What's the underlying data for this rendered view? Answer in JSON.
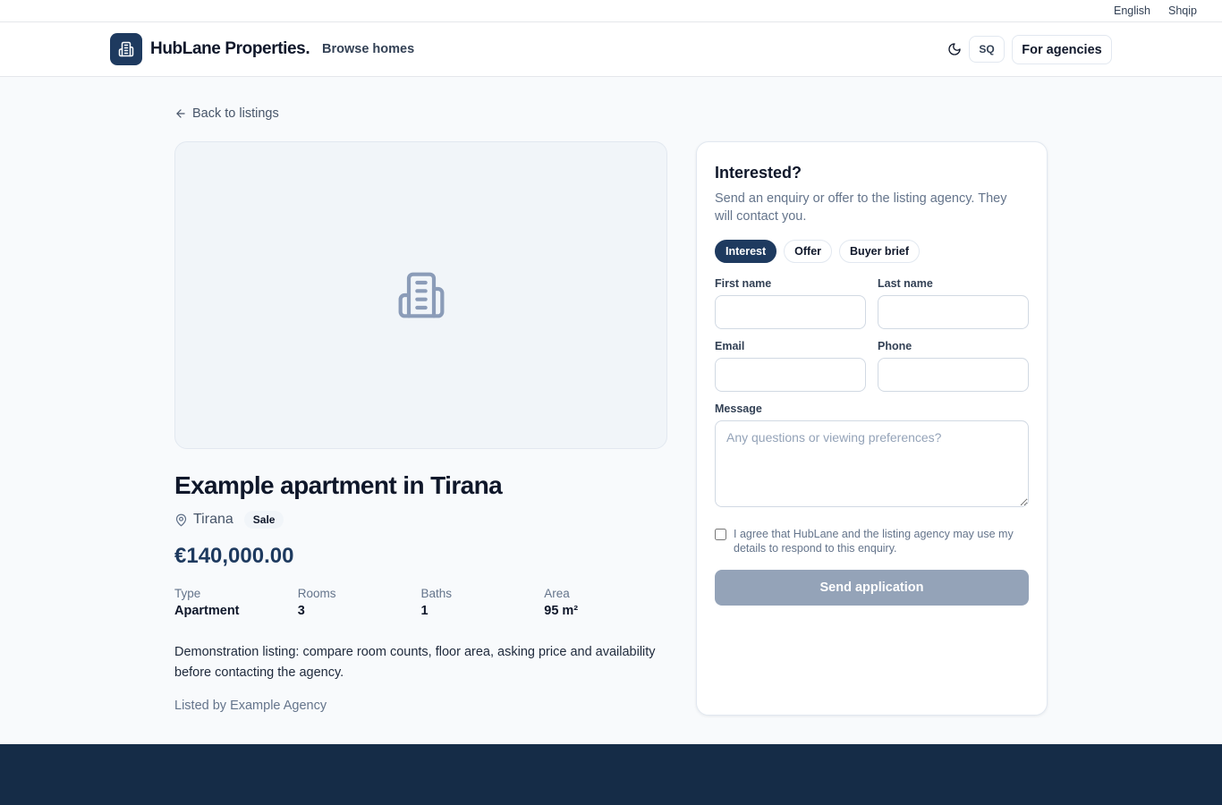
{
  "languages": [
    "English",
    "Shqip"
  ],
  "header": {
    "brand": "HubLane Properties.",
    "nav_browse": "Browse homes",
    "theme_icon": "moon-icon",
    "lang_short": "SQ",
    "agencies_label": "For agencies"
  },
  "back_link": "Back to listings",
  "listing": {
    "image_icon": "building-icon",
    "title": "Example apartment in Tirana",
    "location": "Tirana",
    "badge": "Sale",
    "price": "€140,000.00",
    "specs": [
      {
        "label": "Type",
        "value": "Apartment"
      },
      {
        "label": "Rooms",
        "value": "3"
      },
      {
        "label": "Baths",
        "value": "1"
      },
      {
        "label": "Area",
        "value": "95 m²"
      }
    ],
    "description": "Demonstration listing: compare room counts, floor area, asking price and availability before contacting the agency.",
    "listed_by": "Listed by Example Agency"
  },
  "enquiry": {
    "title": "Interested?",
    "subtitle": "Send an enquiry or offer to the listing agency. They will contact you.",
    "tabs": [
      {
        "label": "Interest",
        "active": true
      },
      {
        "label": "Offer",
        "active": false
      },
      {
        "label": "Buyer brief",
        "active": false
      }
    ],
    "fields": {
      "first_name": {
        "label": "First name",
        "value": ""
      },
      "last_name": {
        "label": "Last name",
        "value": ""
      },
      "email": {
        "label": "Email",
        "value": ""
      },
      "phone": {
        "label": "Phone",
        "value": ""
      },
      "message": {
        "label": "Message",
        "value": "",
        "placeholder": "Any questions or viewing preferences?"
      }
    },
    "consent": "I agree that HubLane and the listing agency may use my details to respond to this enquiry.",
    "submit_label": "Send application"
  },
  "colors": {
    "brand": "#1e3a5f",
    "footer": "#152c47",
    "button_disabled": "#94a3b8"
  }
}
